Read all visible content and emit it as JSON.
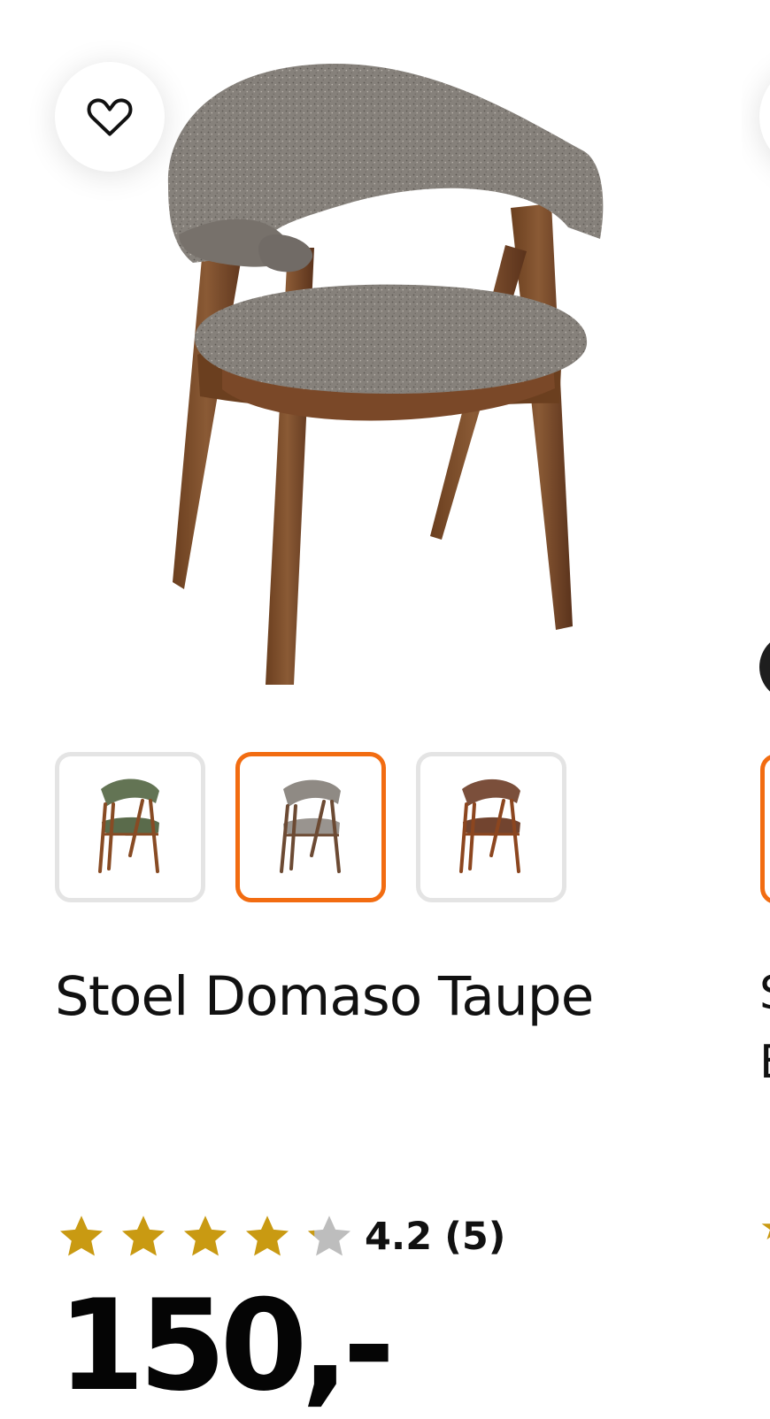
{
  "product": {
    "title": "Stoel Domaso Taupe",
    "rating": "4.2",
    "review_count": "(5)",
    "price": "150,-",
    "stars": 4.2,
    "colors": {
      "accent": "#f26c11",
      "star": "#c99a12",
      "star_empty": "#bdbdbd"
    }
  },
  "favorite": {
    "icon": "heart-icon"
  },
  "variants": [
    {
      "name": "green-chair",
      "color": "#637454"
    },
    {
      "name": "taupe-chair",
      "color": "#8f8a84",
      "selected": true
    },
    {
      "name": "brown-chair",
      "color": "#7b4f3b"
    }
  ],
  "next_card": {
    "title_line_1": "S",
    "title_line_2": "E"
  }
}
